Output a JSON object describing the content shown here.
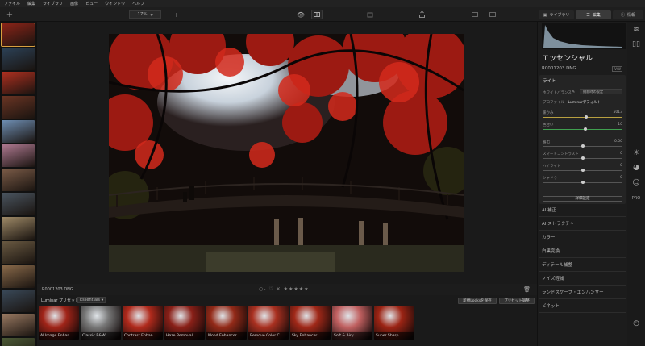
{
  "menu": [
    "ファイル",
    "編集",
    "ライブラリ",
    "画像",
    "ビュー",
    "ウインドウ",
    "ヘルプ"
  ],
  "toolbar": {
    "add": "+",
    "zoom_value": "17%",
    "zoom_minus": "—",
    "zoom_plus": "+",
    "tabs": [
      {
        "label": "ライブラリ"
      },
      {
        "label": "編集"
      },
      {
        "label": "情報"
      }
    ]
  },
  "filmstrip": {
    "thumbs": [
      "#8c2418",
      "#2c4258",
      "#b03020",
      "#6b3524",
      "#6f8fb4",
      "#b07a92",
      "#7c5c48",
      "#4a5560",
      "#a08b68",
      "#6a5a42",
      "#8a6a4a",
      "#3a4a5a",
      "#9a7a62",
      "#4c5a36"
    ]
  },
  "info": {
    "filename": "R0001203.DNG",
    "rating_prefix": "○-",
    "heart": "♡",
    "reject": "✕",
    "stars": "★★★★★",
    "trash": "🗑"
  },
  "presets": {
    "title": "Luminar プリセット",
    "category": "Essentials",
    "save_button": "新規Looksを保存",
    "adjust_button": "プリセット調整",
    "items": [
      {
        "label": "AI Image Enhan...",
        "tint": "#a02418"
      },
      {
        "label": "Classic B&W",
        "tint": "#777777"
      },
      {
        "label": "Contrast Enhan...",
        "tint": "#b02a1c"
      },
      {
        "label": "Haze Removal",
        "tint": "#8a2018"
      },
      {
        "label": "Mood Enhancer",
        "tint": "#932a18"
      },
      {
        "label": "Remove Color C...",
        "tint": "#a93020"
      },
      {
        "label": "Sky Enhancer",
        "tint": "#a02818"
      },
      {
        "label": "Soft & Airy",
        "tint": "#c06060"
      },
      {
        "label": "Super Sharp",
        "tint": "#9c2414"
      }
    ]
  },
  "panel": {
    "title": "エッセンシャル",
    "filename": "R0001203.DNG",
    "badge": "RAW",
    "light": {
      "heading": "ライト",
      "wb_label": "ホワイトバランス",
      "wb_value": "撮影時の設定",
      "profile_label": "プロファイル",
      "profile_value": "Luminarデフォルト",
      "sliders": [
        {
          "label": "暖かみ",
          "value": "5013",
          "pos": 0.55,
          "color": "#b8a040"
        },
        {
          "label": "色合い",
          "value": "10",
          "pos": 0.54,
          "color": "#40a050"
        },
        {
          "label": "露出",
          "value": "0.00",
          "pos": 0.5,
          "color": "#555555"
        },
        {
          "label": "スマートコントラスト",
          "value": "0",
          "pos": 0.5,
          "color": "#555555"
        },
        {
          "label": "ハイライト",
          "value": "0",
          "pos": 0.5,
          "color": "#555555"
        },
        {
          "label": "シャドウ",
          "value": "0",
          "pos": 0.5,
          "color": "#555555"
        }
      ],
      "advanced_button": "詳細設定"
    },
    "tools": [
      "AI 補正",
      "AI ストラクチャ",
      "カラー",
      "白黒変換",
      "ディテール補整",
      "ノイズ軽減",
      "ランドスケープ・エンハンサー",
      "ビネット"
    ]
  },
  "icons": [
    "layers-icon",
    "compare-icon",
    "sun-icon",
    "palette-icon",
    "smiley-icon",
    "pro-icon",
    "history-icon"
  ]
}
